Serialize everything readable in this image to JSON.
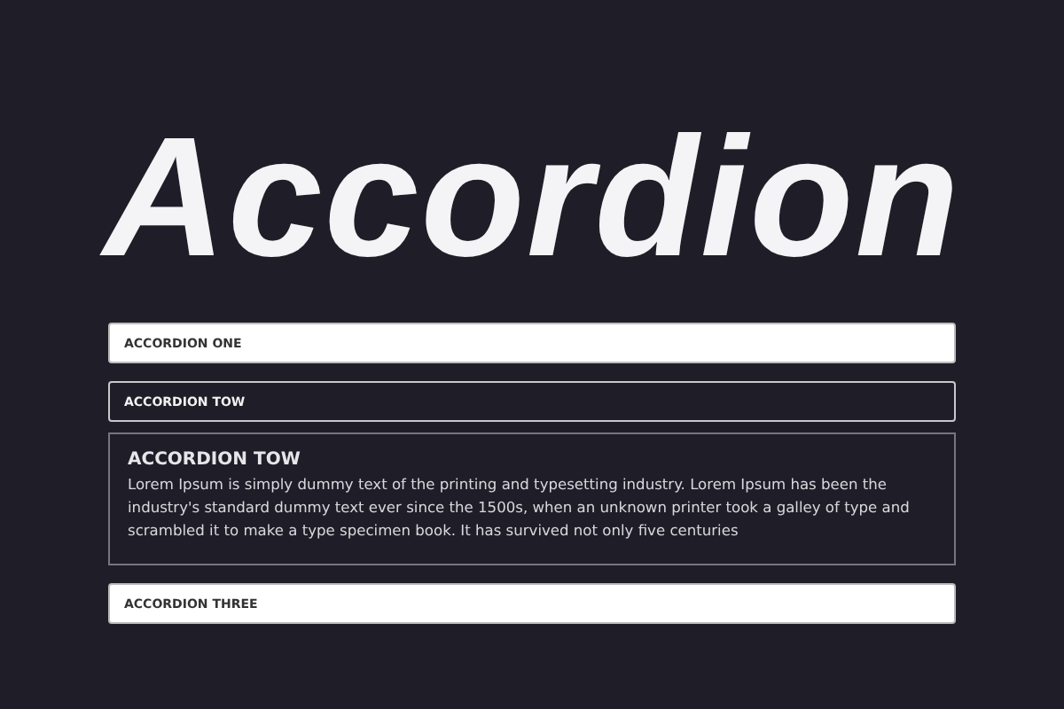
{
  "title": "Accordion",
  "items": [
    {
      "label": "ACCORDION ONE",
      "expanded": false
    },
    {
      "label": "ACCORDION TOW",
      "expanded": true,
      "panel": {
        "heading": "ACCORDION TOW",
        "text": "Lorem Ipsum is simply dummy text of the printing and typesetting industry. Lorem Ipsum has been the industry's standard dummy text ever since the 1500s, when an unknown printer took a galley of type and scrambled it to make a type specimen book. It has survived not only five centuries"
      }
    },
    {
      "label": "ACCORDION THREE",
      "expanded": false
    }
  ]
}
